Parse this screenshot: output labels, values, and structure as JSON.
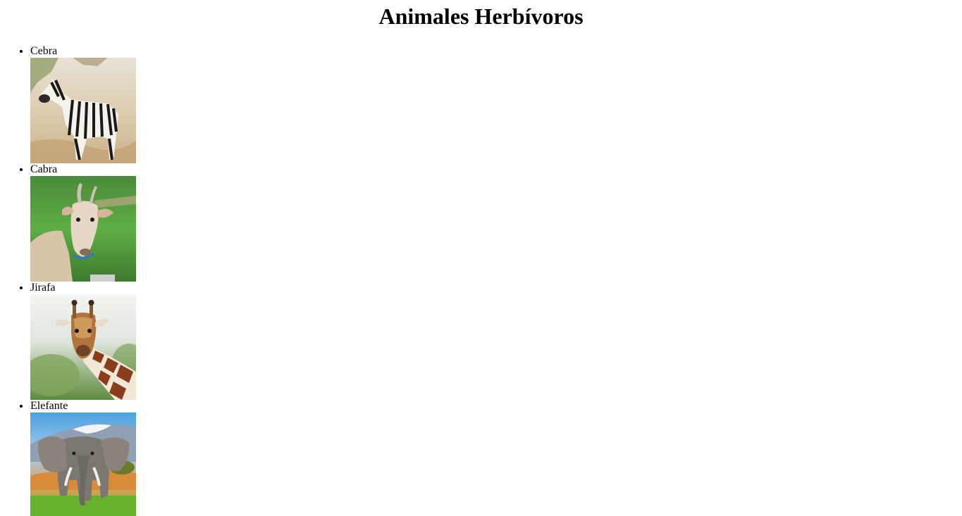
{
  "page": {
    "title": "Animales Herbívoros"
  },
  "animals": [
    {
      "name": "Cebra",
      "icon": "zebra-photo"
    },
    {
      "name": "Cabra",
      "icon": "goat-photo"
    },
    {
      "name": "Jirafa",
      "icon": "giraffe-photo"
    },
    {
      "name": "Elefante",
      "icon": "elephant-photo"
    }
  ]
}
